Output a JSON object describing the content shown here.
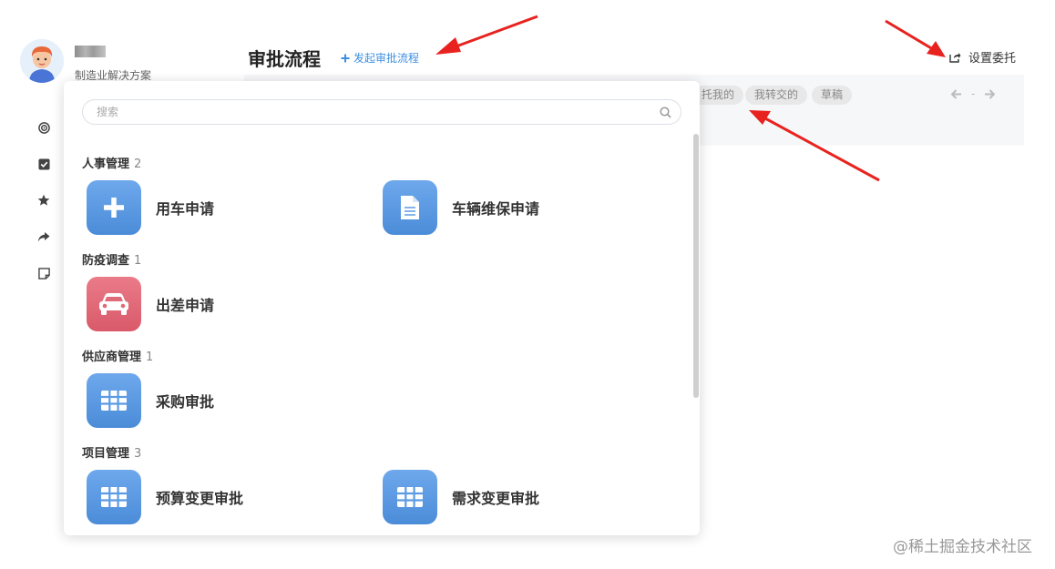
{
  "user": {
    "org": "制造业解决方案"
  },
  "header": {
    "title": "审批流程",
    "start_flow_label": "发起审批流程",
    "delegate_label": "设置委托"
  },
  "filters": {
    "chips": [
      "托我的",
      "我转交的",
      "草稿"
    ],
    "pager_separator": "-"
  },
  "popover": {
    "search_placeholder": "搜索",
    "groups": [
      {
        "name": "人事管理",
        "count": "2",
        "apps": [
          {
            "label": "用车申请",
            "icon": "plus-icon",
            "color": "blue"
          },
          {
            "label": "车辆维保申请",
            "icon": "document-icon",
            "color": "blue"
          }
        ]
      },
      {
        "name": "防疫调查",
        "count": "1",
        "apps": [
          {
            "label": "出差申请",
            "icon": "car-icon",
            "color": "red"
          }
        ]
      },
      {
        "name": "供应商管理",
        "count": "1",
        "apps": [
          {
            "label": "采购审批",
            "icon": "table-icon",
            "color": "blue"
          }
        ]
      },
      {
        "name": "项目管理",
        "count": "3",
        "apps": [
          {
            "label": "预算变更审批",
            "icon": "table-icon",
            "color": "blue"
          },
          {
            "label": "需求变更审批",
            "icon": "table-icon",
            "color": "blue"
          }
        ]
      }
    ]
  },
  "rail_icons": [
    "target-icon",
    "checkbox-icon",
    "star-icon",
    "share-icon",
    "note-icon"
  ],
  "colors": {
    "accent_blue": "#3d8fe0",
    "app_blue": "#5b9be3",
    "app_red": "#e06a78",
    "annotation_red": "#e8231f"
  },
  "watermark": "@稀土掘金技术社区"
}
